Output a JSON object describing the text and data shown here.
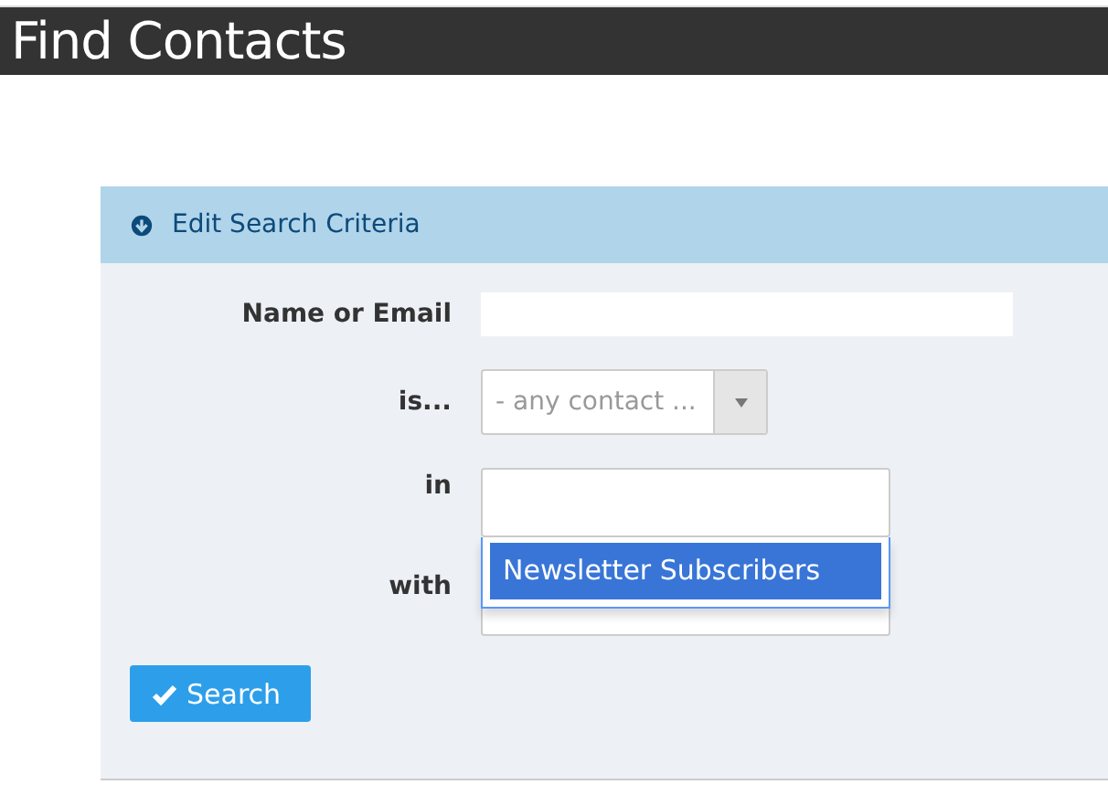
{
  "page": {
    "title": "Find Contacts"
  },
  "panel": {
    "title": "Edit Search Criteria",
    "expanded": true
  },
  "fields": [
    {
      "kind": "text",
      "label": "Name or Email"
    },
    {
      "kind": "select",
      "label": "is...",
      "value": "- any contact ..."
    },
    {
      "kind": "multiselect",
      "label": "in",
      "options": [
        {
          "label": "Newsletter Subscribers",
          "selected": true
        }
      ]
    },
    {
      "kind": "tags",
      "label": "with"
    }
  ],
  "buttons": [
    {
      "label": "Search"
    }
  ]
}
